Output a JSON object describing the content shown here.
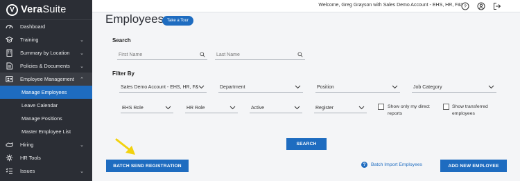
{
  "brand": {
    "mark": "V",
    "name_bold": "Vera",
    "name_light": "Suite"
  },
  "sidebar": {
    "items": [
      {
        "label": "Dashboard",
        "icon": "dashboard-icon",
        "chevron": false
      },
      {
        "label": "Training",
        "icon": "training-icon",
        "chevron": true
      },
      {
        "label": "Summary by Location",
        "icon": "building-icon",
        "chevron": true
      },
      {
        "label": "Policies & Documents",
        "icon": "documents-icon",
        "chevron": true
      },
      {
        "label": "Employee Management",
        "icon": "employees-icon",
        "chevron": true,
        "expanded": true
      },
      {
        "label": "Hiring",
        "icon": "hiring-icon",
        "chevron": true
      },
      {
        "label": "HR Tools",
        "icon": "hr-tools-icon",
        "chevron": false
      },
      {
        "label": "Issues",
        "icon": "issues-icon",
        "chevron": true
      }
    ],
    "subitems": [
      {
        "label": "Manage Employees",
        "active": true
      },
      {
        "label": "Leave Calendar"
      },
      {
        "label": "Manage Positions"
      },
      {
        "label": "Master Employee List"
      }
    ]
  },
  "topbar": {
    "welcome": "Welcome, Greg Grayson with Sales Demo Account - EHS, HR, F&I",
    "icons": [
      "help-icon",
      "user-icon",
      "logout-icon"
    ]
  },
  "page": {
    "title": "Employees",
    "tour_label": "Take a Tour"
  },
  "search": {
    "label": "Search",
    "first_name_placeholder": "First Name",
    "last_name_placeholder": "Last Name"
  },
  "filters": {
    "label": "Filter By",
    "account": "Sales Demo Account - EHS, HR, F&I",
    "department": "Department",
    "position": "Position",
    "job_category": "Job Category",
    "ehs_role": "EHS Role",
    "hr_role": "HR Role",
    "status": "Active",
    "register": "Register",
    "direct_reports_label": "Show only my direct reports",
    "transferred_label": "Show transferred employees"
  },
  "actions": {
    "search_label": "SEARCH",
    "batch_send_label": "BATCH SEND REGISTRATION",
    "batch_import_label": "Batch Import Employees",
    "add_employee_label": "ADD NEW EMPLOYEE"
  },
  "colors": {
    "sidebar_bg": "#2b2e35",
    "accent": "#1e6cc0",
    "arrow": "#f2d20f"
  }
}
